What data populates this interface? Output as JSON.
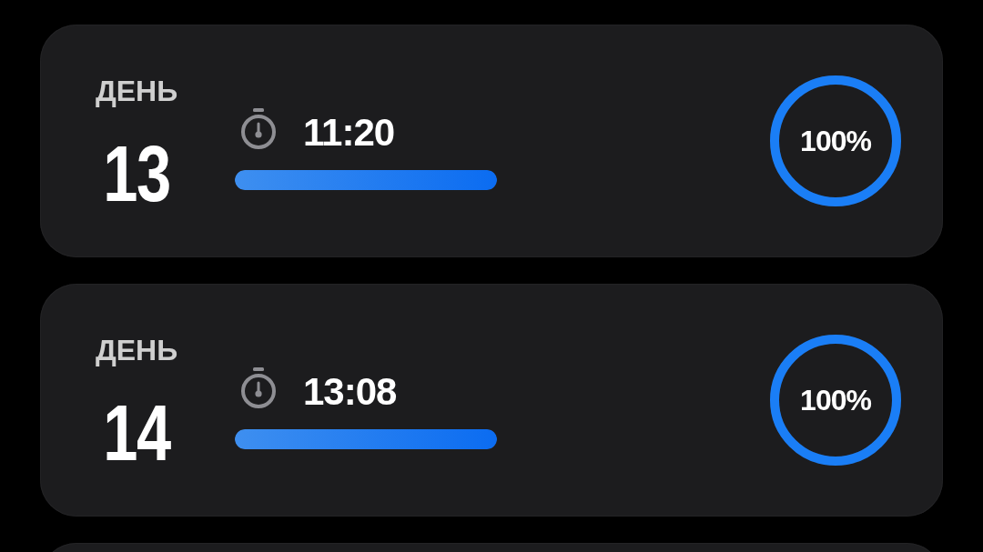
{
  "cards": [
    {
      "day_label": "ДЕНЬ",
      "day": "13",
      "time": "11:20",
      "progress": {
        "level": 1
      },
      "ring": {
        "level": 1,
        "reading": "100%"
      }
    },
    {
      "day_label": "ДЕНЬ",
      "day": "14",
      "time": "13:08",
      "progress": {
        "level": 1
      },
      "ring": {
        "level": 1,
        "reading": "100%"
      }
    }
  ]
}
